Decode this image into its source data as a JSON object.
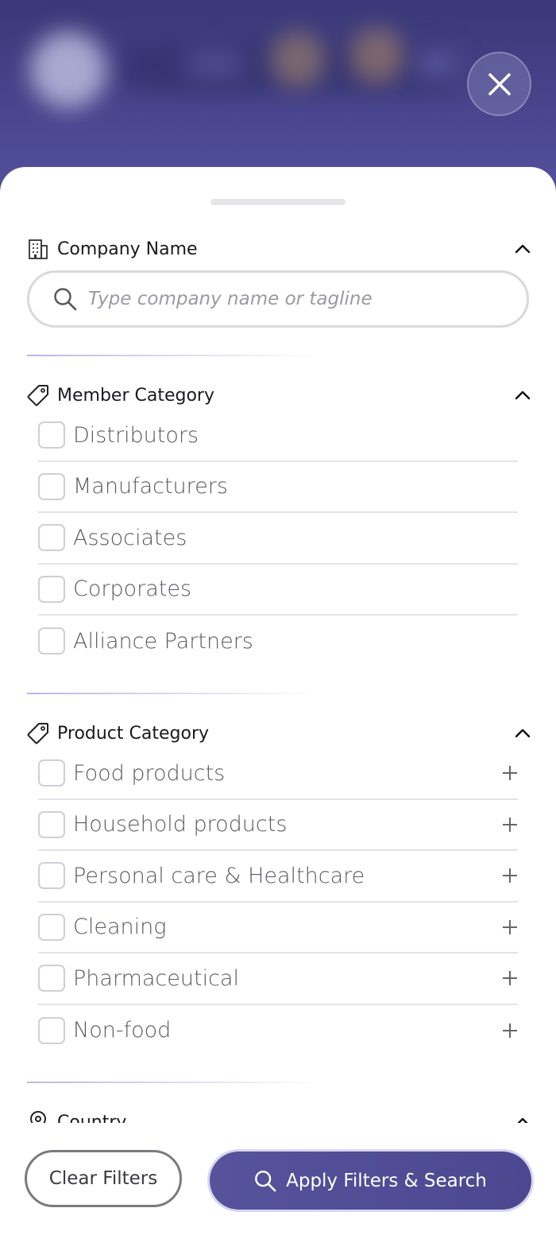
{
  "header": {
    "close_icon": "close-icon"
  },
  "company_section": {
    "title": "Company Name",
    "icon": "building-icon",
    "search_placeholder": "Type company name or tagline"
  },
  "member_section": {
    "title": "Member Category",
    "icon": "tag-icon",
    "options": [
      "Distributors",
      "Manufacturers",
      "Associates",
      "Corporates",
      "Alliance Partners"
    ]
  },
  "product_section": {
    "title": "Product Category",
    "icon": "tag-icon",
    "options": [
      "Food products",
      "Household products",
      "Personal care & Healthcare",
      "Cleaning",
      "Pharmaceutical",
      "Non-food"
    ]
  },
  "country_section": {
    "title": "Country",
    "icon": "location-pin-icon"
  },
  "footer": {
    "clear_label": "Clear Filters",
    "apply_label": "Apply Filters & Search"
  },
  "colors": {
    "accent": "#4b4890",
    "backdrop": "#3f3d7e"
  }
}
